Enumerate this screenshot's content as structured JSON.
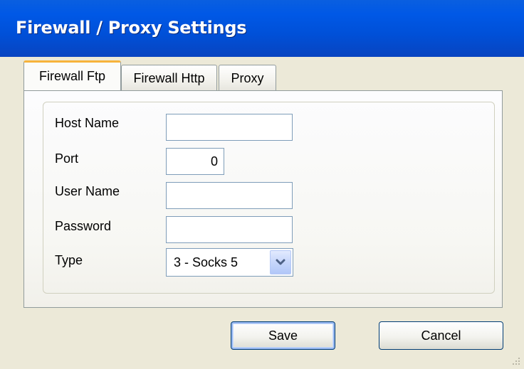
{
  "window": {
    "title": "Firewall / Proxy Settings"
  },
  "tabs": [
    {
      "label": "Firewall Ftp",
      "active": true
    },
    {
      "label": "Firewall Http",
      "active": false
    },
    {
      "label": "Proxy",
      "active": false
    }
  ],
  "form": {
    "host_name": {
      "label": "Host Name",
      "value": ""
    },
    "port": {
      "label": "Port",
      "value": "0"
    },
    "user_name": {
      "label": "User Name",
      "value": ""
    },
    "password": {
      "label": "Password",
      "value": ""
    },
    "type": {
      "label": "Type",
      "selected": "3 - Socks 5"
    }
  },
  "buttons": {
    "save_label": "Save",
    "cancel_label": "Cancel"
  },
  "icons": {
    "dropdown": "chevron-down-icon",
    "resize": "resize-grip-icon"
  },
  "colors": {
    "titlebar": "#0054e3",
    "window_bg": "#ece9d8",
    "tab_highlight": "#f7b33b",
    "field_border": "#7f9db9",
    "button_border": "#003c74"
  }
}
